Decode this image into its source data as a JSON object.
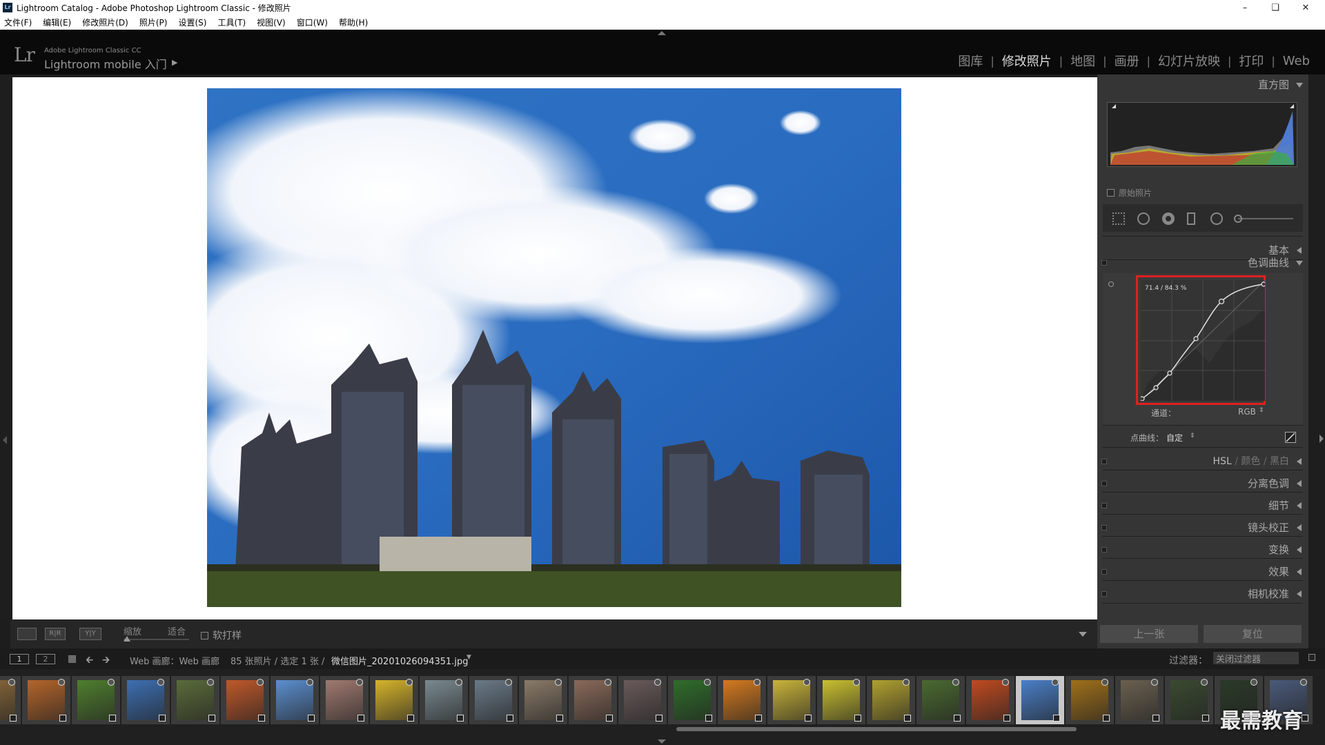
{
  "window": {
    "title": "Lightroom Catalog - Adobe Photoshop Lightroom Classic - 修改照片",
    "controls": [
      "minimize-icon",
      "restore-icon",
      "close-icon"
    ]
  },
  "menu": [
    "文件(F)",
    "编辑(E)",
    "修改照片(D)",
    "照片(P)",
    "设置(S)",
    "工具(T)",
    "视图(V)",
    "窗口(W)",
    "帮助(H)"
  ],
  "identity": {
    "logo": "Lr",
    "product": "Adobe Lightroom Classic CC",
    "mobile": "Lightroom mobile 入门"
  },
  "modules": [
    {
      "label": "图库",
      "active": false
    },
    {
      "label": "修改照片",
      "active": true
    },
    {
      "label": "地图",
      "active": false
    },
    {
      "label": "画册",
      "active": false
    },
    {
      "label": "幻灯片放映",
      "active": false
    },
    {
      "label": "打印",
      "active": false
    },
    {
      "label": "Web",
      "active": false
    }
  ],
  "toolbar": {
    "zoom_label": "缩放",
    "fit_label": "适合",
    "softproof_label": "软打样"
  },
  "right_panel": {
    "histogram_title": "直方图",
    "original_photo": "原始照片",
    "basic": "基本",
    "tone_curve": "色调曲线",
    "curve_readout": "71.4 / 84.3 %",
    "channel_label": "通道：",
    "channel_value": "RGB",
    "point_curve_label": "点曲线：",
    "point_curve_value": "自定",
    "hsl": "HSL",
    "color": "颜色",
    "bw": "黑白",
    "sections": [
      "分离色调",
      "细节",
      "镜头校正",
      "变换",
      "效果",
      "相机校准"
    ],
    "prev_button": "上一张",
    "reset_button": "复位"
  },
  "filmstrip_bar": {
    "page1": "1",
    "page2": "2",
    "source": "Web 画廊：Web 画廊",
    "count": "85 张照片 / 选定 1 张 /",
    "filename": "微信图片_20201026094351.jpg",
    "filter_label": "过滤器：",
    "filter_value": "关闭过滤器"
  },
  "filmstrip": {
    "selected_index": 21,
    "thumbs": [
      "#8b6a3a",
      "#b5652a",
      "#4f7f2e",
      "#3d6fb3",
      "#5b6b3a",
      "#c0582a",
      "#5b8fd0",
      "#a07a70",
      "#d6b42a",
      "#7a8a90",
      "#6a7a88",
      "#8a7a68",
      "#8a6a5a",
      "#6a5a5a",
      "#2f6d2a",
      "#d47a20",
      "#c9b43a",
      "#c9c030",
      "#b0a030",
      "#4a6a30",
      "#c04a20",
      "#4a7fc8",
      "#a0701a",
      "#6a6050",
      "#3a4a30",
      "#2a3a28",
      "#4a5a7a"
    ]
  },
  "watermark": "最需教育"
}
